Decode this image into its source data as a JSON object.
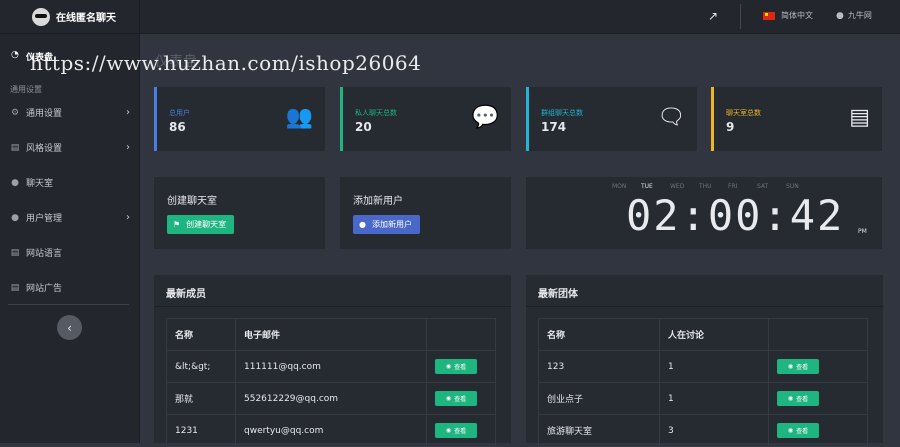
{
  "brand": {
    "title": "在线匿名聊天"
  },
  "watermark": "https://www.huzhan.com/ishop26064",
  "sidebar": {
    "dashboard": "仪表盘",
    "section": "通用设置",
    "items": [
      {
        "label": "通用设置",
        "icon": "gear-icon",
        "has_arrow": true
      },
      {
        "label": "风格设置",
        "icon": "palette-icon",
        "has_arrow": true
      },
      {
        "label": "聊天室",
        "icon": "chat-icon",
        "has_arrow": false
      },
      {
        "label": "用户管理",
        "icon": "users-icon",
        "has_arrow": true
      },
      {
        "label": "网站语言",
        "icon": "language-icon",
        "has_arrow": false
      },
      {
        "label": "网站广告",
        "icon": "ad-icon",
        "has_arrow": false
      }
    ],
    "collapse_icon": "chevron-left-icon"
  },
  "topbar": {
    "language": "简体中文",
    "username": "九牛网"
  },
  "main": {
    "watermark_title": "仪表盘"
  },
  "stats": [
    {
      "label": "总用户",
      "value": "86",
      "color": "#4a7de0",
      "icon": "users-icon"
    },
    {
      "label": "私人聊天总数",
      "value": "20",
      "color": "#1fb580",
      "icon": "comment-icon"
    },
    {
      "label": "群组聊天总数",
      "value": "174",
      "color": "#22b5d6",
      "icon": "comments-icon"
    },
    {
      "label": "聊天室总数",
      "value": "9",
      "color": "#f0b429",
      "icon": "room-icon"
    }
  ],
  "actions": {
    "create_room": {
      "title": "创建聊天室",
      "button": "创建聊天室",
      "color": "#1fb580"
    },
    "add_user": {
      "title": "添加新用户",
      "button": "添加新用户",
      "color": "#4a68c9"
    }
  },
  "clock": {
    "days": [
      "MON",
      "TUE",
      "WED",
      "THU",
      "FRI",
      "SAT",
      "SUN"
    ],
    "active_day": "TUE",
    "time": "02:00:42",
    "ampm": "PM"
  },
  "members": {
    "title": "最新成员",
    "columns": [
      "名称",
      "电子邮件",
      ""
    ],
    "rows": [
      {
        "name": "&lt;&gt;",
        "email": "111111@qq.com",
        "action": "查看"
      },
      {
        "name": "那就",
        "email": "552612229@qq.com",
        "action": "查看"
      },
      {
        "name": "1231",
        "email": "qwertyu@qq.com",
        "action": "查看"
      }
    ]
  },
  "groups": {
    "title": "最新团体",
    "columns": [
      "名称",
      "人在讨论",
      ""
    ],
    "rows": [
      {
        "name": "123",
        "count": "1",
        "action": "查看"
      },
      {
        "name": "创业点子",
        "count": "1",
        "action": "查看"
      },
      {
        "name": "旅游聊天室",
        "count": "3",
        "action": "查看"
      }
    ]
  }
}
